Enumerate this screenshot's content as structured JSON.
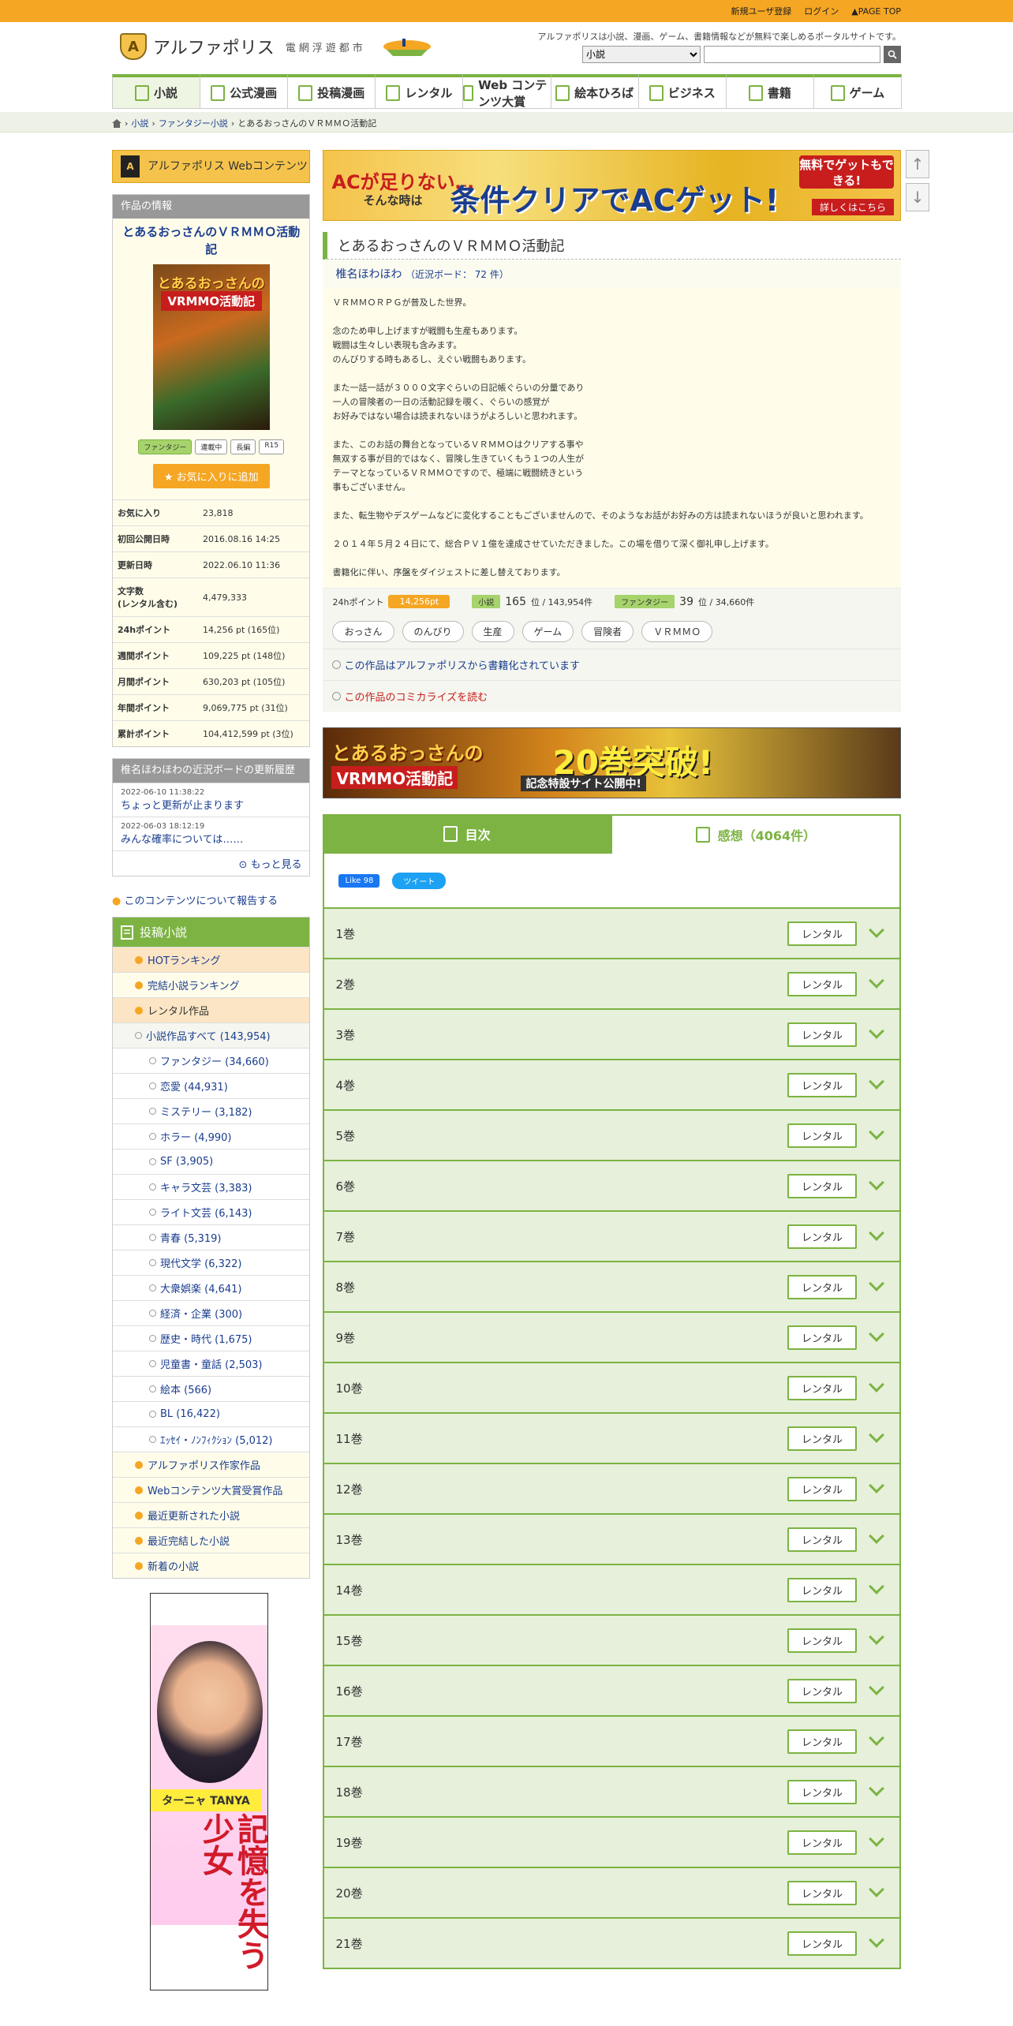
{
  "topbar": {
    "register": "新規ユーザ登録",
    "login": "ログイン",
    "pagetop": "PAGE TOP"
  },
  "header": {
    "site_name": "アルファポリス",
    "sub": "電網浮遊都市",
    "tagline": "アルファポリスは小説、漫画、ゲーム、書籍情報などが無料で楽しめるポータルサイトです。",
    "search_select": "小説",
    "search_options": [
      "小説"
    ]
  },
  "nav": [
    {
      "label": "小説"
    },
    {
      "label": "公式漫画"
    },
    {
      "label": "投稿漫画"
    },
    {
      "label": "レンタル"
    },
    {
      "label": "Web コンテンツ大賞"
    },
    {
      "label": "絵本ひろば"
    },
    {
      "label": "ビジネス"
    },
    {
      "label": "書籍"
    },
    {
      "label": "ゲーム"
    }
  ],
  "breadcrumb": {
    "items": [
      "小説",
      "ファンタジー小説",
      "とあるおっさんのＶＲＭＭＯ活動記"
    ]
  },
  "left": {
    "webcontent": "アルファポリス Webコンテンツ",
    "info_header": "作品の情報",
    "work_title": "とあるおっさんのＶＲＭＭＯ活動記",
    "cover_t1": "とあるおっさんの",
    "cover_t2": "VRMMO活動記",
    "tags": [
      "ファンタジー",
      "連載中",
      "長編",
      "R15"
    ],
    "fav_button": "お気に入りに追加",
    "stats": [
      {
        "k": "お気に入り",
        "v": "23,818"
      },
      {
        "k": "初回公開日時",
        "v": "2016.08.16 14:25"
      },
      {
        "k": "更新日時",
        "v": "2022.06.10 11:36"
      },
      {
        "k": "文字数\n(レンタル含む)",
        "v": "4,479,333"
      },
      {
        "k": "24hポイント",
        "v": "14,256 pt (165位)"
      },
      {
        "k": "週間ポイント",
        "v": "109,225 pt (148位)"
      },
      {
        "k": "月間ポイント",
        "v": "630,203 pt (105位)"
      },
      {
        "k": "年間ポイント",
        "v": "9,069,775 pt (31位)"
      },
      {
        "k": "累計ポイント",
        "v": "104,412,599 pt (3位)"
      }
    ],
    "board_header": "椎名ほわほわの近況ボードの更新履歴",
    "board": [
      {
        "date": "2022-06-10 11:38:22",
        "title": "ちょっと更新が止まります"
      },
      {
        "date": "2022-06-03 18:12:19",
        "title": "みんな確率については……"
      }
    ],
    "more": "もっと見る",
    "report": "このコンテンツについて報告する",
    "category_header": "投稿小説",
    "categories": [
      {
        "label": "HOTランキング",
        "lvl": "hot"
      },
      {
        "label": "完結小説ランキング",
        "lvl": "l1"
      },
      {
        "label": "レンタル作品",
        "lvl": "hl"
      },
      {
        "label": "小説作品すべて (143,954)",
        "lvl": "l2"
      },
      {
        "label": "ファンタジー (34,660)",
        "lvl": "l3"
      },
      {
        "label": "恋愛 (44,931)",
        "lvl": "l3"
      },
      {
        "label": "ミステリー (3,182)",
        "lvl": "l3"
      },
      {
        "label": "ホラー (4,990)",
        "lvl": "l3"
      },
      {
        "label": "SF (3,905)",
        "lvl": "l3"
      },
      {
        "label": "キャラ文芸 (3,383)",
        "lvl": "l3"
      },
      {
        "label": "ライト文芸 (6,143)",
        "lvl": "l3"
      },
      {
        "label": "青春 (5,319)",
        "lvl": "l3"
      },
      {
        "label": "現代文学 (6,322)",
        "lvl": "l3"
      },
      {
        "label": "大衆娯楽 (4,641)",
        "lvl": "l3"
      },
      {
        "label": "経済・企業 (300)",
        "lvl": "l3"
      },
      {
        "label": "歴史・時代 (1,675)",
        "lvl": "l3"
      },
      {
        "label": "児童書・童話 (2,503)",
        "lvl": "l3"
      },
      {
        "label": "絵本 (566)",
        "lvl": "l3"
      },
      {
        "label": "BL (16,422)",
        "lvl": "l3"
      },
      {
        "label": "ｴｯｾｲ・ﾉﾝﾌｨｸｼｮﾝ (5,012)",
        "lvl": "l3"
      },
      {
        "label": "アルファポリス作家作品",
        "lvl": "l1"
      },
      {
        "label": "Webコンテンツ大賞受賞作品",
        "lvl": "l1"
      },
      {
        "label": "最近更新された小説",
        "lvl": "l1"
      },
      {
        "label": "最近完結した小説",
        "lvl": "l1"
      },
      {
        "label": "新着の小説",
        "lvl": "l1"
      }
    ],
    "sidebanner_name": "ターニャ TANYA",
    "sidebanner_vt": "記憶を失う少女"
  },
  "main": {
    "banner": {
      "l1": "ACが足りない…",
      "l2": "そんな時は",
      "big": "条件クリアでACゲット!",
      "red": "無料でゲットもできる!",
      "link": "詳しくはこちら"
    },
    "title": "とあるおっさんのＶＲＭＭＯ活動記",
    "author": "椎名ほわほわ",
    "author_board": "（近況ボード： 72 件）",
    "desc": [
      "ＶＲＭＭＯＲＰＧが普及した世界。",
      "念のため申し上げますが戦闘も生産もあります。\n戦闘は生々しい表現も含みます。\nのんびりする時もあるし、えぐい戦闘もあります。",
      "また一話一話が３０００文字ぐらいの日記帳ぐらいの分量であり\n一人の冒険者の一日の活動記録を覗く、ぐらいの感覚が\nお好みではない場合は読まれないほうがよろしいと思われます。",
      "また、このお話の舞台となっているＶＲＭＭＯはクリアする事や\n無双する事が目的ではなく、冒険し生きていくもう１つの人生が\nテーマとなっているＶＲＭＭＯですので、極端に戦闘続きという\n事もございません。",
      "また、転生物やデスゲームなどに変化することもございませんので、そのようなお話がお好みの方は読まれないほうが良いと思われます。",
      "２０１４年５月２４日にて、総合ＰＶ１億を達成させていただきました。この場を借りて深く御礼申し上げます。",
      "書籍化に伴い、序盤をダイジェストに差し替えております。"
    ],
    "points_label": "24hポイント",
    "points": "14,256pt",
    "rank1_label": "小説",
    "rank1": "165",
    "rank1_total": "位 / 143,954件",
    "rank2_label": "ファンタジー",
    "rank2": "39",
    "rank2_total": "位 / 34,660件",
    "keywords": [
      "おっさん",
      "のんびり",
      "生産",
      "ゲーム",
      "冒険者",
      "ＶＲＭＭＯ"
    ],
    "link1": "この作品はアルファポリスから書籍化されています",
    "link2": "この作品のコミカライズを読む",
    "banner2": {
      "t1": "とあるおっさんの",
      "t2": "VRMMO活動記",
      "t3": "20巻突破!",
      "t4": "記念特設サイト公開中!"
    },
    "tab_toc": "目次",
    "tab_review": "感想（4064件）",
    "like": "Like 98",
    "tweet": "ツイート",
    "rental_label": "レンタル",
    "volumes": [
      "1巻",
      "2巻",
      "3巻",
      "4巻",
      "5巻",
      "6巻",
      "7巻",
      "8巻",
      "9巻",
      "10巻",
      "11巻",
      "12巻",
      "13巻",
      "14巻",
      "15巻",
      "16巻",
      "17巻",
      "18巻",
      "19巻",
      "20巻",
      "21巻"
    ]
  }
}
